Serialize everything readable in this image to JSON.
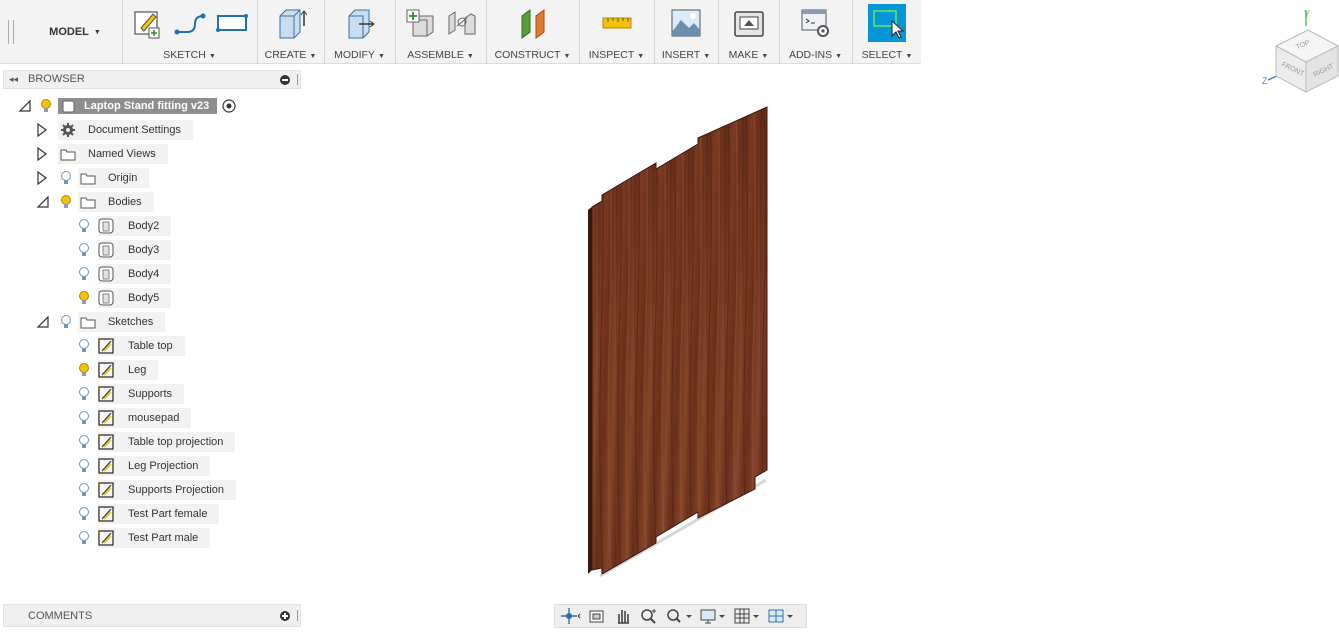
{
  "toolbar": {
    "model_label": "MODEL",
    "groups": {
      "sketch": "SKETCH",
      "create": "CREATE",
      "modify": "MODIFY",
      "assemble": "ASSEMBLE",
      "construct": "CONSTRUCT",
      "inspect": "INSPECT",
      "insert": "INSERT",
      "make": "MAKE",
      "addins": "ADD-INS",
      "select": "SELECT"
    }
  },
  "browser": {
    "title": "BROWSER",
    "root": "Laptop Stand fitting v23",
    "document_settings": "Document Settings",
    "named_views": "Named Views",
    "origin": "Origin",
    "bodies": {
      "label": "Bodies",
      "items": [
        "Body2",
        "Body3",
        "Body4",
        "Body5"
      ]
    },
    "sketches": {
      "label": "Sketches",
      "items": [
        "Table top",
        "Leg",
        "Supports",
        "mousepad",
        "Table top projection",
        "Leg Projection",
        "Supports Projection",
        "Test Part female",
        "Test Part male"
      ]
    }
  },
  "comments": {
    "title": "COMMENTS"
  },
  "viewcube": {
    "top": "TOP",
    "front": "FRONT",
    "right": "RIGHT",
    "axis_y": "Y",
    "axis_z": "Z"
  },
  "colors": {
    "accent": "#0696d7",
    "wood": "#6b2f1c",
    "bulb_on": "#f2c20f",
    "bulb_off": "#a9c8e8"
  }
}
